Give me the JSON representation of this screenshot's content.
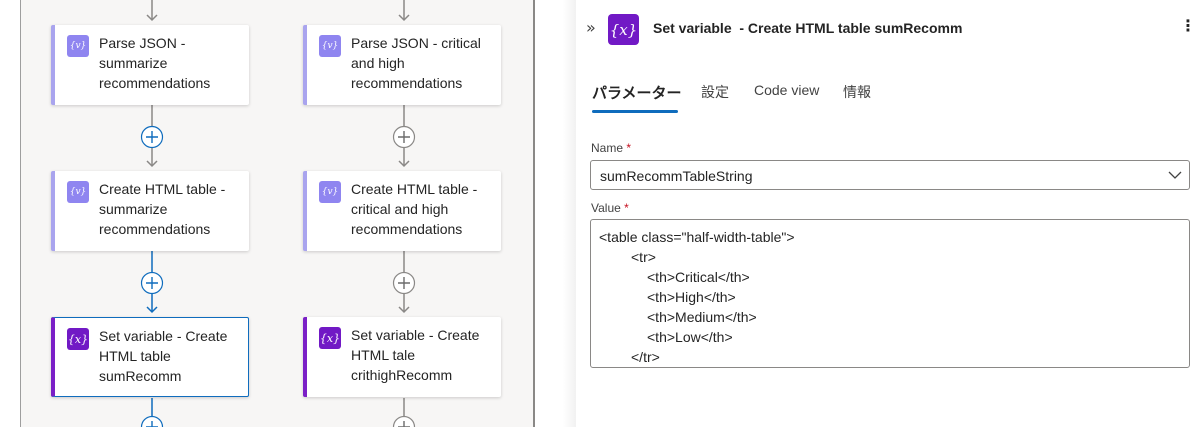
{
  "canvas": {
    "left_column": [
      {
        "title": "Parse JSON - summarize recommendations",
        "icon": "braces-variable-icon",
        "kind": "compose"
      },
      {
        "title": "Create HTML table - summarize recommendations",
        "icon": "braces-variable-icon",
        "kind": "compose"
      },
      {
        "title": "Set variable - Create HTML table sumRecomm",
        "icon": "variable-x-icon",
        "kind": "setvar",
        "selected": true
      }
    ],
    "right_column": [
      {
        "title": "Parse JSON - critical and high recommendations",
        "icon": "braces-variable-icon",
        "kind": "compose"
      },
      {
        "title": "Create HTML table - critical and high recommendations",
        "icon": "braces-variable-icon",
        "kind": "compose"
      },
      {
        "title": "Set variable - Create HTML tale crithighRecomm",
        "icon": "variable-x-icon",
        "kind": "setvar"
      }
    ],
    "icon_glyphs": {
      "compose": "{v}",
      "setvar": "{x}"
    },
    "colors": {
      "accent": "#0f6cbd",
      "connector": "#8a8886",
      "setvar": "#7119c5",
      "compose": "#8f85f0"
    }
  },
  "panel": {
    "collapse_glyph": "»",
    "header_icon": "{x}",
    "title": "Set variable  - Create HTML table sumRecomm",
    "more_glyph": "⋮",
    "tabs": [
      {
        "label": "パラメーター",
        "active": true
      },
      {
        "label": "設定"
      },
      {
        "label": "Code view"
      },
      {
        "label": "情報"
      }
    ],
    "name_label": "Name",
    "name_value": "sumRecommTableString",
    "value_label": "Value",
    "required_mark": "*",
    "value_lines": [
      "<table class=\"half-width-table\">",
      "<tr>",
      "<th>Critical</th>",
      "<th>High</th>",
      "<th>Medium</th>",
      "<th>Low</th>",
      "</tr>"
    ]
  }
}
